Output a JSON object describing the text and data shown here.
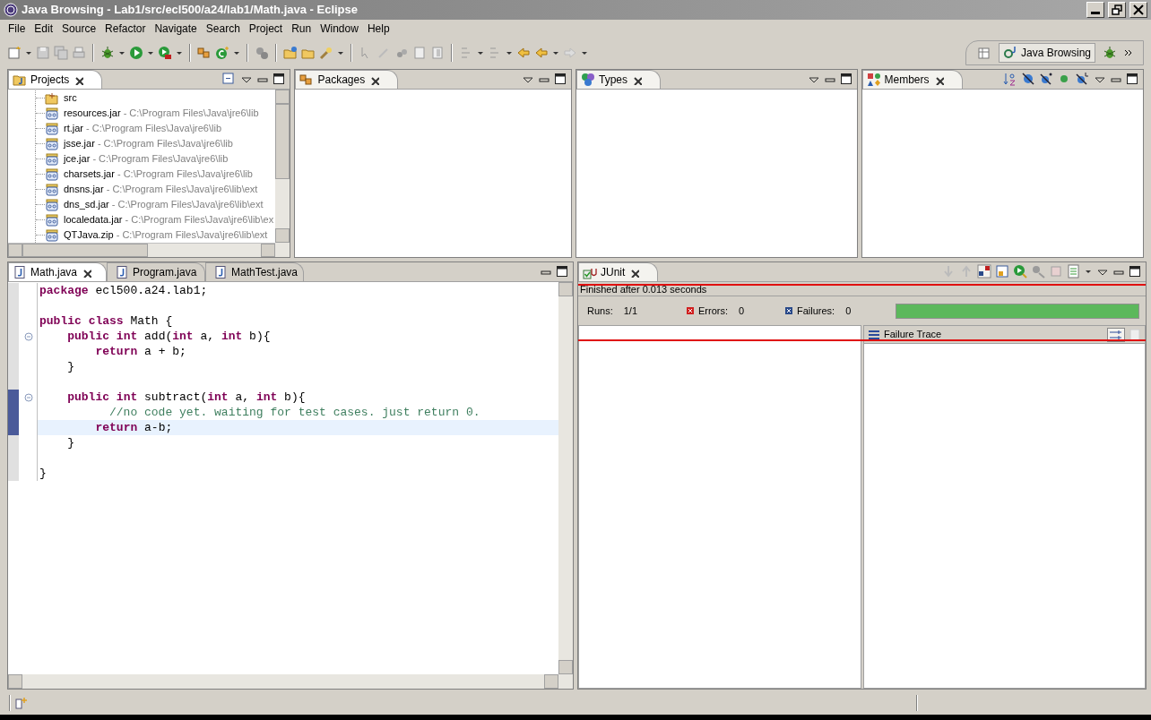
{
  "window": {
    "title": "Java Browsing - Lab1/src/ecl500/a24/lab1/Math.java - Eclipse"
  },
  "menu": [
    "File",
    "Edit",
    "Source",
    "Refactor",
    "Navigate",
    "Search",
    "Project",
    "Run",
    "Window",
    "Help"
  ],
  "perspective": {
    "label": "Java Browsing",
    "selected": true
  },
  "views": [
    {
      "title": "Projects",
      "active": true
    },
    {
      "title": "Packages",
      "active": false
    },
    {
      "title": "Types",
      "active": false
    },
    {
      "title": "Members",
      "active": false
    }
  ],
  "projects_tree": [
    {
      "name": "src",
      "kind": "folder"
    },
    {
      "name": "resources.jar",
      "path": " - C:\\Program Files\\Java\\jre6\\lib",
      "kind": "jar"
    },
    {
      "name": "rt.jar",
      "path": " - C:\\Program Files\\Java\\jre6\\lib",
      "kind": "jar"
    },
    {
      "name": "jsse.jar",
      "path": " - C:\\Program Files\\Java\\jre6\\lib",
      "kind": "jar"
    },
    {
      "name": "jce.jar",
      "path": " - C:\\Program Files\\Java\\jre6\\lib",
      "kind": "jar"
    },
    {
      "name": "charsets.jar",
      "path": " - C:\\Program Files\\Java\\jre6\\lib",
      "kind": "jar"
    },
    {
      "name": "dnsns.jar",
      "path": " - C:\\Program Files\\Java\\jre6\\lib\\ext",
      "kind": "jar"
    },
    {
      "name": "dns_sd.jar",
      "path": " - C:\\Program Files\\Java\\jre6\\lib\\ext",
      "kind": "jar"
    },
    {
      "name": "localedata.jar",
      "path": " - C:\\Program Files\\Java\\jre6\\lib\\ex",
      "kind": "jar"
    },
    {
      "name": "QTJava.zip",
      "path": " - C:\\Program Files\\Java\\jre6\\lib\\ext",
      "kind": "jar"
    }
  ],
  "editor": {
    "tabs": [
      {
        "label": "Math.java",
        "selected": true
      },
      {
        "label": "Program.java",
        "selected": false
      },
      {
        "label": "MathTest.java",
        "selected": false
      }
    ],
    "lines": [
      {
        "kind": "code",
        "code": "**package** ecl500.a24.lab1;",
        "fold": false,
        "changed": false,
        "current": false
      },
      {
        "kind": "blank",
        "fold": false,
        "changed": false,
        "current": false
      },
      {
        "kind": "code",
        "code": "**public** **class** Math {",
        "fold": false,
        "changed": false,
        "current": false
      },
      {
        "kind": "code",
        "code": "    **public** **int** add(**int** a, **int** b){",
        "fold": true,
        "changed": false,
        "current": false
      },
      {
        "kind": "code",
        "code": "        **return** a + b;",
        "fold": false,
        "changed": false,
        "current": false
      },
      {
        "kind": "code",
        "code": "    }",
        "fold": false,
        "changed": false,
        "current": false
      },
      {
        "kind": "blank",
        "fold": false,
        "changed": false,
        "current": false
      },
      {
        "kind": "code",
        "code": "    **public** **int** subtract(**int** a, **int** b){",
        "fold": true,
        "changed": true,
        "current": false
      },
      {
        "kind": "comment",
        "code": "          //no code yet. waiting for test cases. just return 0.",
        "fold": false,
        "changed": true,
        "current": false
      },
      {
        "kind": "code",
        "code": "        **return** a-b;",
        "fold": false,
        "changed": true,
        "current": true
      },
      {
        "kind": "code",
        "code": "    }",
        "fold": false,
        "changed": false,
        "current": false
      },
      {
        "kind": "blank",
        "fold": false,
        "changed": false,
        "current": false
      },
      {
        "kind": "code",
        "code": "}",
        "fold": false,
        "changed": false,
        "current": false
      }
    ]
  },
  "junit": {
    "title": "JUnit",
    "status": "Finished after 0.013 seconds",
    "counters": [
      {
        "label": "Runs:",
        "value": "1/1",
        "kind": "runs"
      },
      {
        "label": "Errors:",
        "value": "0",
        "kind": "errors"
      },
      {
        "label": "Failures:",
        "value": "0",
        "kind": "failures"
      }
    ],
    "progress": {
      "level": 1,
      "color": "#5cb85c"
    },
    "failure_trace": "Failure Trace"
  }
}
